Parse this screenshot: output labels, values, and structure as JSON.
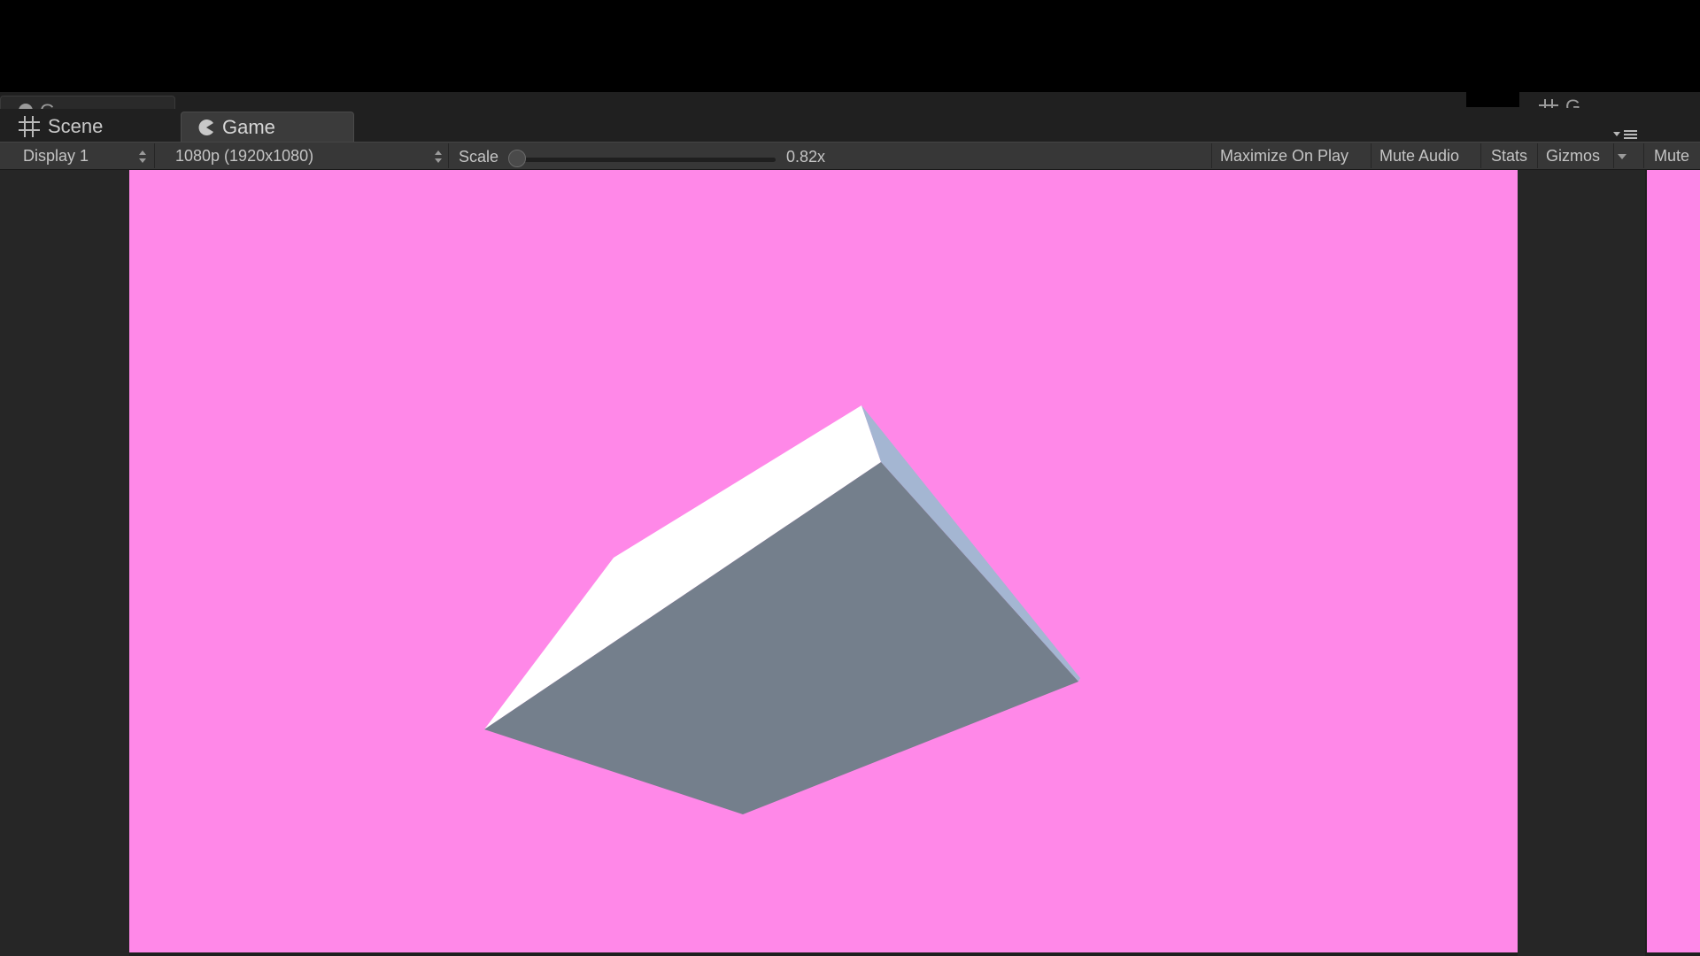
{
  "tabs": {
    "scene_label": "Scene",
    "game_label": "Game",
    "ghost_left_label": "G",
    "ghost_right_label": "G"
  },
  "toolbar": {
    "display_select": "Display 1",
    "resolution_select": "1080p (1920x1080)",
    "scale_label": "Scale",
    "scale_value": "0.82x",
    "scale_fraction": 0.0,
    "maximize_on_play": "Maximize On Play",
    "mute_audio": "Mute Audio",
    "stats": "Stats",
    "gizmos": "Gizmos",
    "mute_audio_right": "Mute"
  },
  "icons": {
    "scene_tab": "grid-icon",
    "game_tab": "pacman-icon",
    "pane_menu": "pane-menu-icon",
    "dropdown": "updown-arrows-icon",
    "gizmos_dropdown": "chevron-down-icon"
  },
  "colors": {
    "game_background": "#ff88e8",
    "cube_front": "#747f8c",
    "cube_top": "#ffffff",
    "cube_side": "#a4b6d2",
    "editor_dark": "#202020",
    "toolbar": "#373737"
  }
}
